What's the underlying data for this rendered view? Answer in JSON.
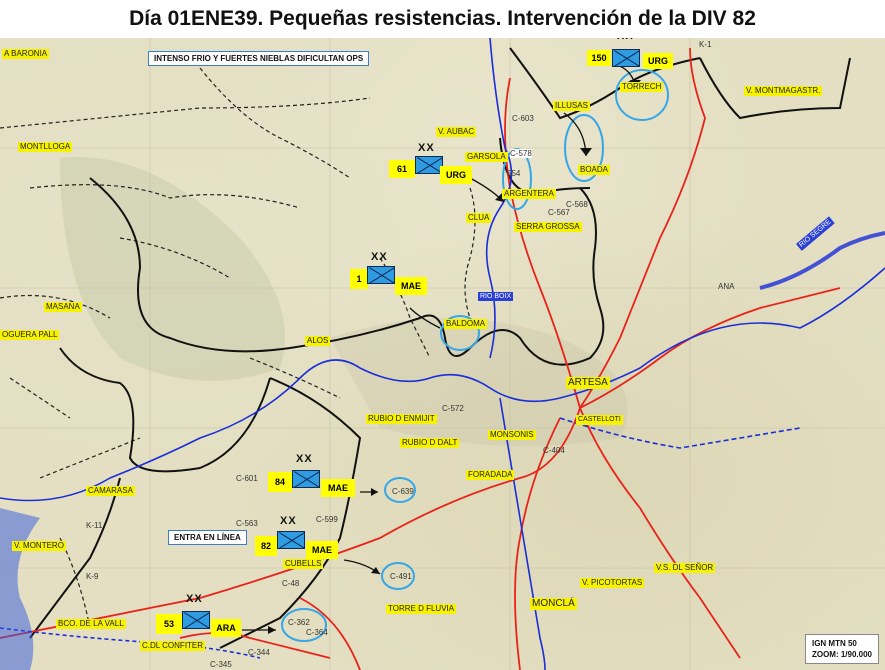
{
  "title": "Día 01ENE39. Pequeñas resistencias. Intervención de la  DIV 82",
  "callouts": {
    "weather": "INTENSO FRIO Y FUERTES NIEBLAS DIFICULTAN OPS",
    "entry": "ENTRA EN LÍNEA"
  },
  "units": [
    {
      "id": "150",
      "tag": "URG",
      "echelon": "XX"
    },
    {
      "id": "61",
      "tag": "URG",
      "echelon": "XX"
    },
    {
      "id": "1",
      "tag": "MAE",
      "echelon": "XX"
    },
    {
      "id": "84",
      "tag": "MAE",
      "echelon": "XX"
    },
    {
      "id": "82",
      "tag": "MAE",
      "echelon": "XX"
    },
    {
      "id": "53",
      "tag": "ARA",
      "echelon": "XX"
    }
  ],
  "places": {
    "baronia": "A BARONIA",
    "montlloga": "MONTLLOGA",
    "aubac": "V. AUBAC",
    "garsola": "GARSOLA",
    "argentera": "ARGENTERA",
    "clua": "CLUA",
    "illusas": "ILLUSAS",
    "boada": "BOADA",
    "torrech": "TORRECH",
    "montmagastr": "V. MONTMAGASTR.",
    "serra_grossa": "SERRA GROSSA",
    "masana": "MASANA",
    "noguera_pall": "OGUERA PALL",
    "alos": "ALOS",
    "baldoma": "BALDOMA",
    "artesa": "ARTESA",
    "castelloti": "CASTELLOTI",
    "rubio_enmijit": "RUBIO D ENMIJIT",
    "rubio_dalt": "RUBIO D DALT",
    "monsonis": "MONSONIS",
    "foradada": "FORADADA",
    "camarasa": "CAMARASA",
    "cubells": "CUBELLS",
    "montero": "V. MONTERO",
    "bco_vall": "BCO. DE LA VALL",
    "torre_fluvia": "TORRE D FLUVIA",
    "confiter": "C.DL CONFITER",
    "picotortas": "V. PICOTORTAS",
    "senor": "V.S. DL SEÑOR",
    "moncla": "MONCLÁ"
  },
  "roads": {
    "c603": "C-603",
    "c578": "C-578",
    "c554": "554",
    "c567": "C-567",
    "c568": "C-568",
    "c572": "C-572",
    "c601": "C-601",
    "c563": "C-563",
    "c599": "C-599",
    "c639": "C-639",
    "c491": "C-491",
    "c484": "C-48",
    "c362": "C-362",
    "c364": "C-364",
    "c344": "C-344",
    "c345": "C-345",
    "c404": "C-404",
    "k1": "K-1",
    "k11": "K-11",
    "k9": "K-9",
    "ana": "ANA",
    "c1": "K-1"
  },
  "rivers": {
    "segre": "RIO SEGRE",
    "boix": "RIO BOIX"
  },
  "scale": {
    "line1": "IGN MTN 50",
    "line2": "ZOOM: 1/90.000"
  },
  "colors": {
    "unit_fill": "#2f9be0",
    "label_bg": "#f6f200",
    "river": "#1a2ed8",
    "road": "#e8231a",
    "objective": "#35a6e6"
  }
}
